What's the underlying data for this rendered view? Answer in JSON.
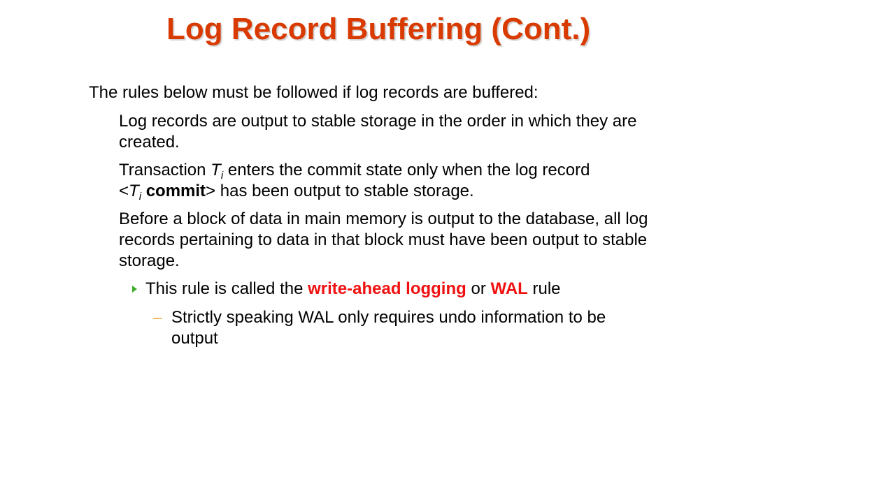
{
  "slide": {
    "title": "Log Record Buffering (Cont.)",
    "intro": "The rules below must be followed if log records are buffered:",
    "rule1": "Log records are output to stable storage in the order in which they are created.",
    "rule2": {
      "word_transaction": "Transaction ",
      "var_T": "T",
      "sub_i": "i",
      "after_var": " enters the commit state only when the log record",
      "open_angle": "<",
      "commit_word": "commit",
      "close_rest": "> has been output to stable storage."
    },
    "rule3": "Before a block of data in main memory is output to the database, all log records pertaining to data in that block must have been output to stable storage.",
    "subrule": {
      "before": "This rule is called the ",
      "term1": "write-ahead logging",
      "middle": " or ",
      "term2": "WAL",
      "after": " rule"
    },
    "note": "Strictly speaking WAL only requires undo information to be output",
    "note_marker": "–"
  },
  "colors": {
    "title": "#d93a00",
    "emphasis": "#f01010",
    "arrow_bullet": "#3fae2a",
    "dash_bullet": "#f2a93b",
    "text": "#000000"
  },
  "icons": {
    "level3_bullet": "green-triangle-arrow",
    "level4_bullet": "orange-dash"
  }
}
